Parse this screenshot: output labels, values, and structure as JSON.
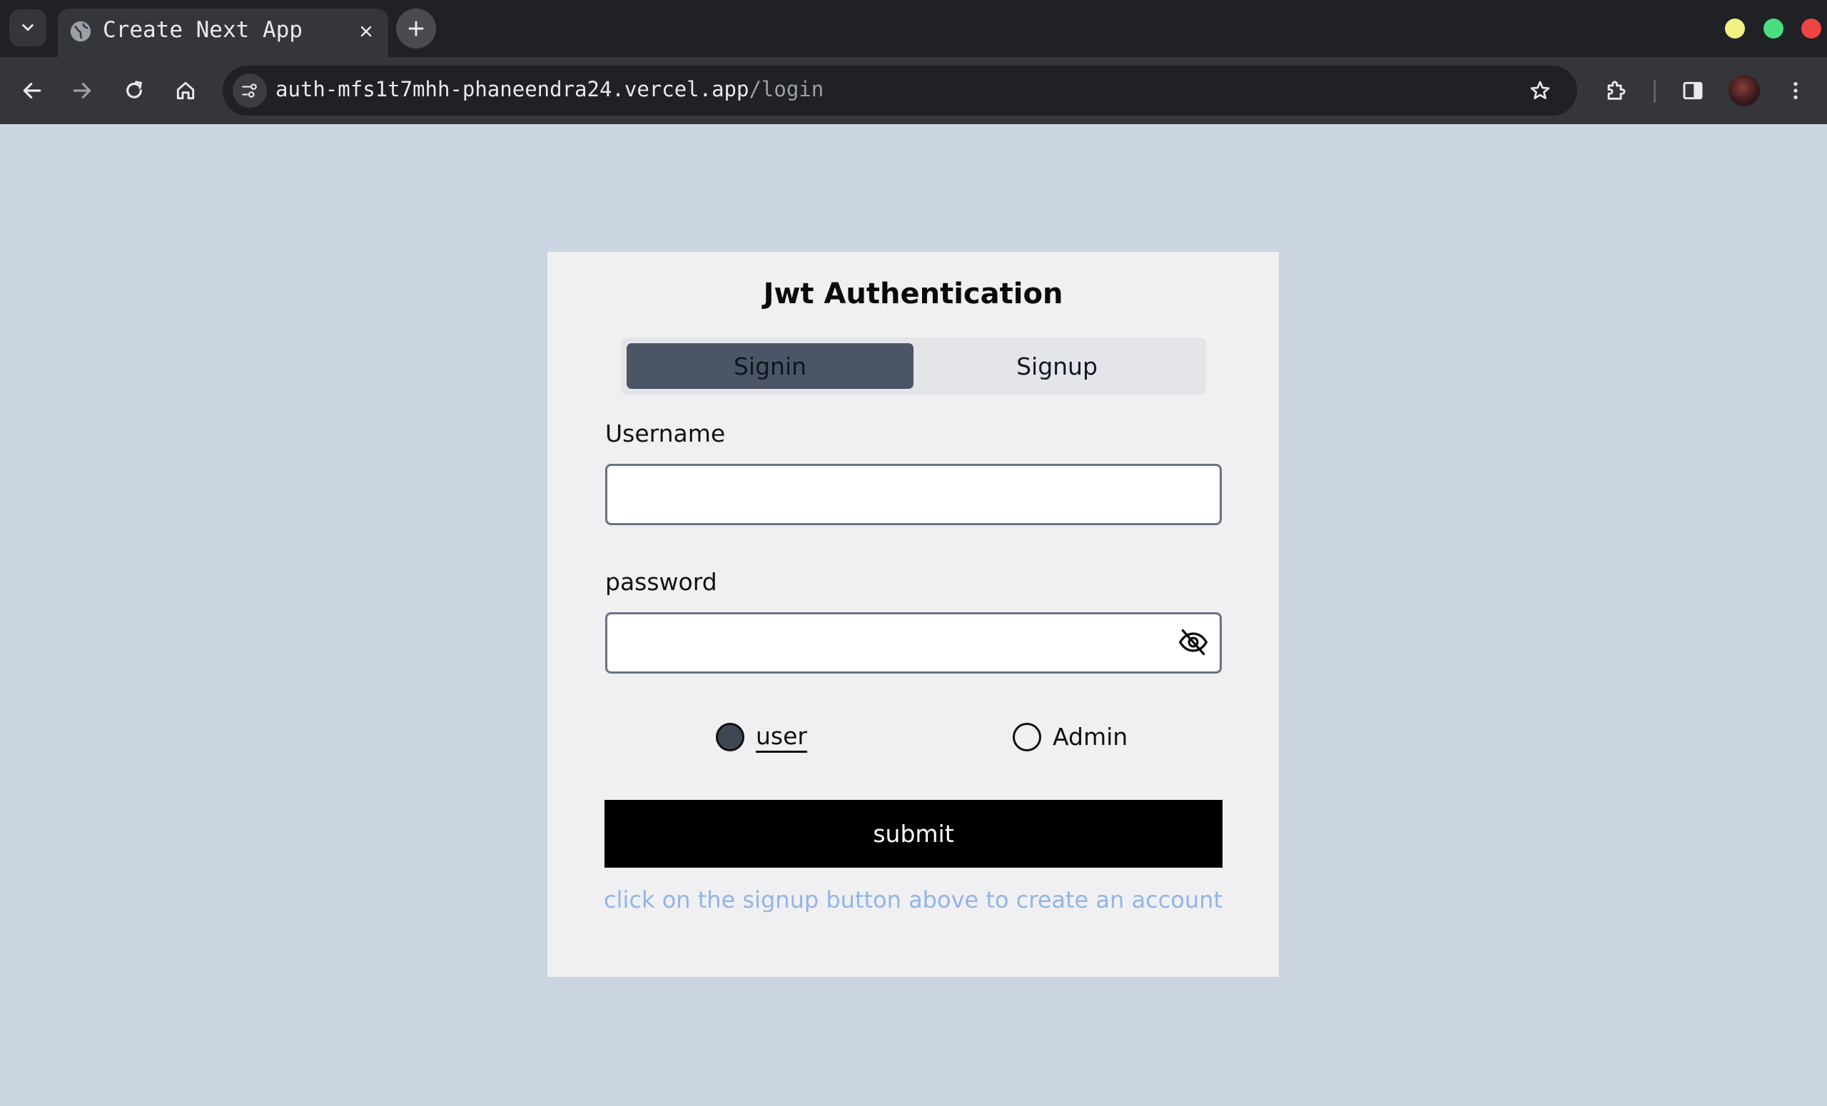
{
  "browser": {
    "tab": {
      "title": "Create Next App",
      "favicon": "globe-icon"
    },
    "address_bar": {
      "host": "auth-mfs1t7mhh-phaneendra24.vercel.app",
      "path": "/login"
    },
    "window_controls": {
      "colors": [
        "#f1f184",
        "#4ade80",
        "#ef4444"
      ]
    },
    "icons": [
      "tab-search-icon",
      "close-icon",
      "plus-icon",
      "back-arrow-icon",
      "forward-arrow-icon",
      "reload-icon",
      "home-icon",
      "site-settings-icon",
      "star-icon",
      "extensions-icon",
      "sidepanel-icon",
      "profile-avatar",
      "kebab-menu-icon"
    ]
  },
  "page": {
    "background": "#cbd5e1",
    "card": {
      "title": "Jwt Authentication",
      "tabs": [
        {
          "label": "Signin",
          "active": true
        },
        {
          "label": "Signup",
          "active": false
        }
      ],
      "username_label": "Username",
      "username_value": "",
      "password_label": "password",
      "password_value": "",
      "role_options": [
        {
          "label": "user",
          "checked": true
        },
        {
          "label": "Admin",
          "checked": false
        }
      ],
      "submit_label": "submit",
      "hint": "click on the signup button above to create an account",
      "colors": {
        "active_tab": "#4b5565",
        "submit_bg": "#000000",
        "hint": "#93b4e8"
      }
    }
  }
}
